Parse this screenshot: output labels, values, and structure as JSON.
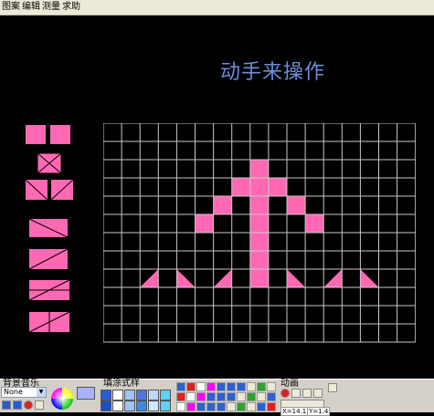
{
  "menu": {
    "items": [
      "图案",
      "编辑",
      "测量",
      "求助"
    ]
  },
  "canvas": {
    "title": "动手来操作",
    "title_color": "#6a8edc",
    "grid_color": "#c8c8c8",
    "shape_color": "#ff69b4",
    "background": "#000000"
  },
  "palette": {
    "shape_icons": [
      "two-squares-icon",
      "x-square-icon",
      "split-square-icon",
      "diagonal-rect-icon",
      "diagonal-rect-icon",
      "split-rect-icon",
      "split-rect-icon"
    ]
  },
  "toolbar": {
    "music_label": "背景音乐",
    "music_select": "None",
    "fill_label": "填涂式样",
    "anim_label": "动画",
    "coord_x": "X=14.1",
    "coord_y": "Y=1.4"
  }
}
